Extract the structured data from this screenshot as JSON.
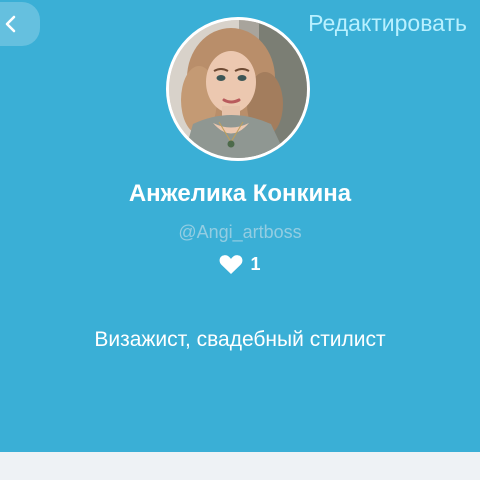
{
  "header": {
    "back_icon": "chevron-left-icon",
    "edit_label": "Редактировать"
  },
  "profile": {
    "avatar_description": "profile photo",
    "name": "Анжелика Конкина",
    "username": "@Angi_artboss",
    "like_icon": "heart-icon",
    "likes_count": "1",
    "bio": "Визажист, свадебный стилист"
  },
  "colors": {
    "background": "#3aafd6",
    "edit_link": "#b8f0ff",
    "username": "#93cde2",
    "bottom_bar": "#eef2f5"
  }
}
